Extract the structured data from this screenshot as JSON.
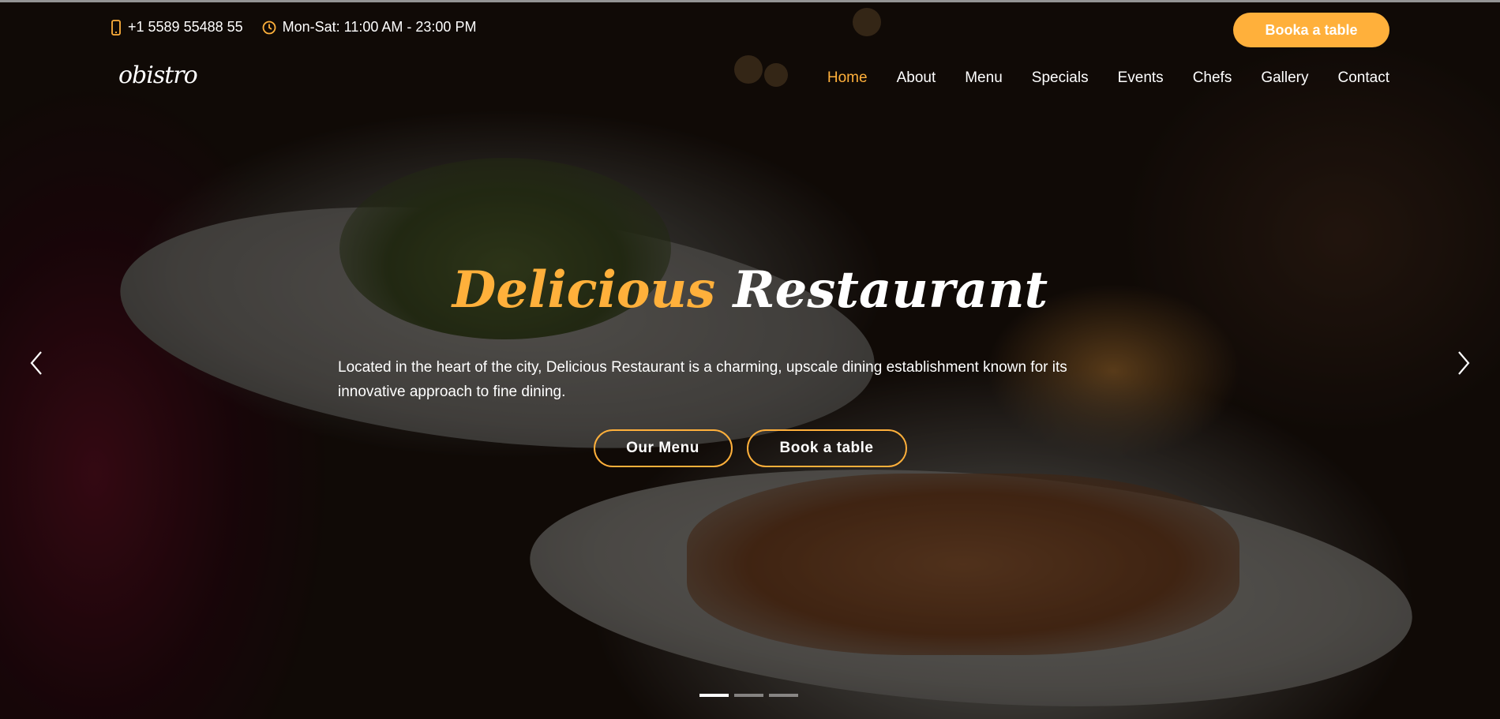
{
  "topbar": {
    "phone": "+1 5589 55488 55",
    "hours": "Mon-Sat: 11:00 AM - 23:00 PM",
    "book_button": "Booka a table",
    "phone_icon": "phone-icon",
    "clock_icon": "clock-icon"
  },
  "header": {
    "logo": "obistro",
    "nav": [
      "Home",
      "About",
      "Menu",
      "Specials",
      "Events",
      "Chefs",
      "Gallery",
      "Contact"
    ],
    "active": "Home"
  },
  "hero": {
    "title_accent": "Delicious",
    "title_main": "Restaurant",
    "description": "Located in the heart of the city, Delicious Restaurant is a charming, upscale dining establishment known for its innovative approach to fine dining.",
    "primary_button": "Our Menu",
    "secondary_button": "Book a table"
  },
  "carousel": {
    "prev_icon": "chevron-left-icon",
    "next_icon": "chevron-right-icon",
    "indicator_count": 3,
    "active_index": 0
  },
  "colors": {
    "accent": "#ffb03b",
    "text": "#ffffff"
  }
}
